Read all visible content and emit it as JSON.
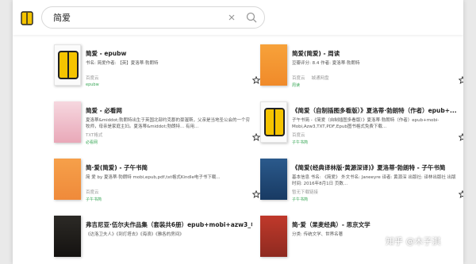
{
  "search": {
    "value": "简爱"
  },
  "results": [
    {
      "title": "简爱 - epubw",
      "desc": "书名: 简爱作者: 【英】夏洛蒂·勃朗特",
      "meta": [
        "百度云"
      ],
      "source": "epubw"
    },
    {
      "title": "简爱(简爱) - 周读",
      "desc": "豆瓣评分: 8.4 作者: 夏洛蒂·勃朗特",
      "meta": [
        "百度云",
        "城通网盘"
      ],
      "source": "周读"
    },
    {
      "title": "简爱 - 必看网",
      "desc": "夏洛蒂&middot;勃朗特出生于英国北部约克郡的豪渥斯，父亲是当地圣公会的一个穷牧师，母亲是家庭主妇。夏洛蒂&middot;勃朗特... 有用...",
      "meta": [
        "TXT格式"
      ],
      "source": "必看网"
    },
    {
      "title": "《简爱（自制插图多看版）》夏洛蒂·勃朗特（作者）epub+...",
      "desc": "子午书简 -《简爱（自制插图多看版）》夏洛蒂·勃朗特（作者）epub+mobi-Mobi,Azw3,TXT,PDF,Epub图书格式免费下载...",
      "meta": [
        "百度云"
      ],
      "source": "子午书简"
    },
    {
      "title": "简·爱(简爱) - 子午书简",
      "desc": "简 爱 by 夏洛蒂·勃朗特 mobi,epub,pdf,txt格式Kindle电子书下载...",
      "meta": [
        "百度云"
      ],
      "source": "子午书简"
    },
    {
      "title": "《简爱(经典译林版·黄源深译)》夏洛蒂·勃朗特 - 子午书简",
      "desc": "基本信息 书名: 《简爱》 外文书名: Janeeyre 译者: 黄源深 出版社: 译林出版社 出版时间: 2016年8月1日 页数...",
      "meta": [
        "暂无下载链接"
      ],
      "source": "子午书简"
    },
    {
      "title": "弗吉尼亚·伍尔夫作品集（套装共6册）epub+mobi+azw3_电...",
      "desc": "《达洛卫夫人》《到灯塔去》《海浪》《雅各的房间》",
      "meta": [],
      "source": ""
    },
    {
      "title": "简·爱（果麦经典）- 思京文学",
      "desc": "分类: 传统文学、世界名著",
      "meta": [],
      "source": ""
    }
  ],
  "icons": {
    "app": "book-icon",
    "clear": "close-icon",
    "search": "search-icon",
    "star": "star-icon"
  },
  "colors": {
    "accent": "#f5c400",
    "source_green": "#3aa757"
  },
  "watermark": "知乎 @木子淇"
}
